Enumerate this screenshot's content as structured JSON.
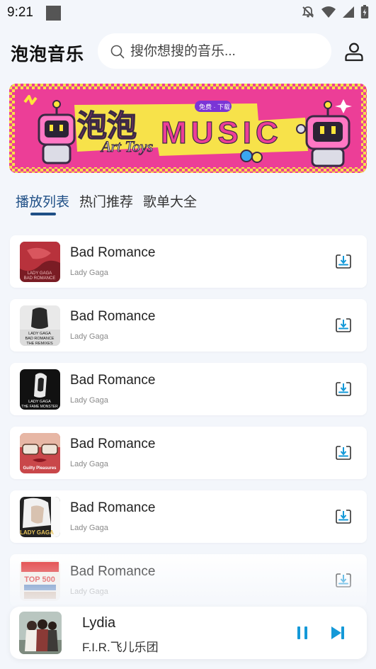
{
  "status_bar": {
    "time": "9:21"
  },
  "header": {
    "app_title": "泡泡音乐",
    "search_placeholder": "搜你想搜的音乐..."
  },
  "banner": {
    "word1": "泡泡",
    "word2": "MUSIC",
    "sub": "Art Toys",
    "tag": "免费 · 下载"
  },
  "tabs": [
    {
      "label": "播放列表",
      "active": true
    },
    {
      "label": "热门推荐",
      "active": false
    },
    {
      "label": "歌单大全",
      "active": false
    }
  ],
  "songs": [
    {
      "title": "Bad Romance",
      "artist": "Lady Gaga",
      "cover_text": "LADY GAGA\nBAD ROMANCE"
    },
    {
      "title": "Bad Romance",
      "artist": "Lady Gaga",
      "cover_text": "LADY GAGA\nBAD ROMANCE\nTHE REMIXES"
    },
    {
      "title": "Bad Romance",
      "artist": "Lady Gaga",
      "cover_text": "LADY GAGA\nTHE FAME MONSTER"
    },
    {
      "title": "Bad Romance",
      "artist": "Lady Gaga",
      "cover_text": "Guilty Pleasures"
    },
    {
      "title": "Bad Romance",
      "artist": "Lady Gaga",
      "cover_text": "LADY GAGA"
    },
    {
      "title": "Bad Romance",
      "artist": "Lady Gaga",
      "cover_text": "TOP 500"
    }
  ],
  "player": {
    "title": "Lydia",
    "artist": "F.I.R.飞儿乐团"
  },
  "colors": {
    "accent": "#1f4f86",
    "play_blue": "#1499d8",
    "banner_pink": "#ec3e97",
    "banner_yellow": "#f7e24a",
    "background": "#f3f6fb"
  }
}
